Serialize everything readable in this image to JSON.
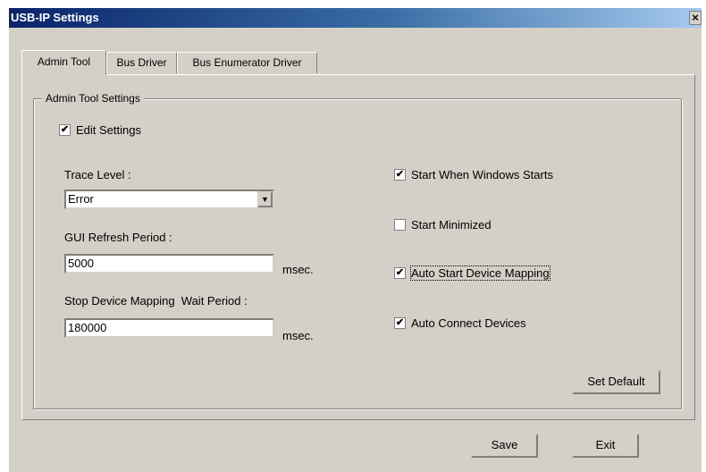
{
  "window": {
    "title": "USB-IP Settings",
    "close_glyph": "×"
  },
  "tabs": [
    {
      "label": "Admin Tool",
      "active": true
    },
    {
      "label": "Bus Driver",
      "active": false
    },
    {
      "label": "Bus Enumerator Driver",
      "active": false
    }
  ],
  "group": {
    "legend": "Admin Tool Settings"
  },
  "edit_settings": {
    "label": "Edit Settings",
    "checked": true
  },
  "trace_level": {
    "label": "Trace Level :",
    "value": "Error",
    "arrow": "▼"
  },
  "gui_refresh": {
    "label": "GUI Refresh Period :",
    "value": "5000",
    "unit": "msec."
  },
  "stop_wait": {
    "label": "Stop Device Mapping  Wait Period :",
    "value": "180000",
    "unit": "msec."
  },
  "options": [
    {
      "label": "Start When Windows Starts",
      "checked": true
    },
    {
      "label": "Start Minimized",
      "checked": false
    },
    {
      "label": "Auto Start Device Mapping",
      "checked": true
    },
    {
      "label": "Auto Connect Devices",
      "checked": true
    }
  ],
  "check_mark": "✔",
  "buttons": {
    "set_default": "Set Default",
    "save": "Save",
    "exit": "Exit"
  }
}
